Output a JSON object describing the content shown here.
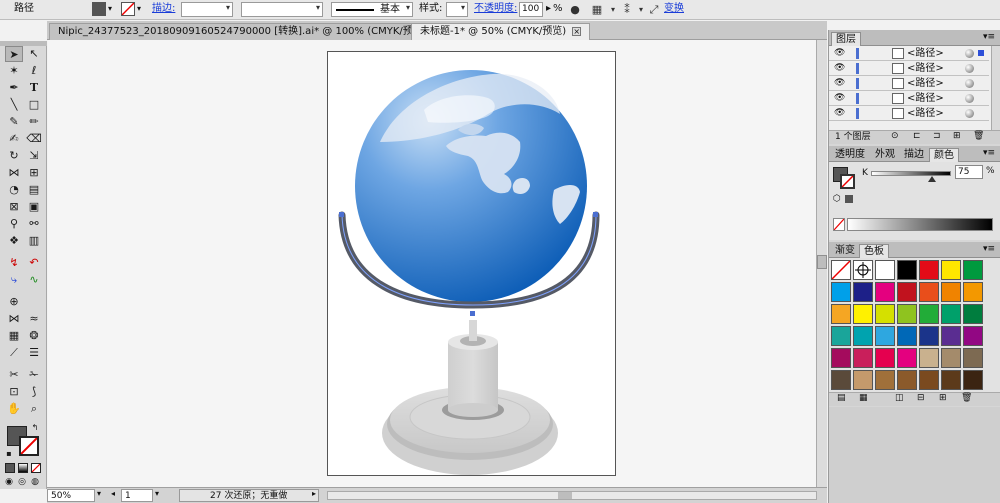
{
  "control_bar": {
    "object_type": "路径",
    "stroke_label": "描边:",
    "stroke_profile": "基本",
    "style_label": "样式:",
    "opacity_label": "不透明度:",
    "opacity_value": "100",
    "opacity_unit": "%",
    "transform_label": "变换"
  },
  "tabs": [
    {
      "title": "Nipic_24377523_20180909160524790000   [转换].ai* @ 100% (CMYK/预览)"
    },
    {
      "title": "未标题-1* @ 50% (CMYK/预览)"
    }
  ],
  "status_bar": {
    "zoom": "50%",
    "artboard_index": "1",
    "message": "27 次还原；无重做"
  },
  "layers_panel": {
    "title": "图层",
    "rows": [
      {
        "name": "<路径>"
      },
      {
        "name": "<路径>"
      },
      {
        "name": "<路径>"
      },
      {
        "name": "<路径>"
      },
      {
        "name": "<路径>"
      }
    ],
    "layer_count": "1 个图层"
  },
  "color_panel": {
    "tabs": [
      "透明度",
      "外观",
      "描边",
      "颜色"
    ],
    "channel_label": "K",
    "channel_value": "75",
    "channel_unit": "%",
    "channel_fraction": 0.75
  },
  "swatches_panel": {
    "tabs": [
      "渐变",
      "色板"
    ],
    "colors": [
      "none",
      "registration",
      "#ffffff",
      "#000000",
      "#e30b17",
      "#ffe600",
      "#009a3e",
      "#00a0e9",
      "#1d2088",
      "#e4007f",
      "#c1121e",
      "#e94e1b",
      "#f08300",
      "#f39800",
      "#f5a623",
      "#fff100",
      "#d5e000",
      "#8fc31f",
      "#22ac38",
      "#00a06a",
      "#007d3e",
      "#1aa59a",
      "#00a3af",
      "#2ea7e0",
      "#0068b7",
      "#1b348a",
      "#5a2d91",
      "#920783",
      "#a40b5d",
      "#c91f5b",
      "#e5004f",
      "#e4007f",
      "#c9b18e",
      "#a48b6b",
      "#7d6a52",
      "#5a4a3a",
      "#c49a6c",
      "#a0703a",
      "#8b5a2b",
      "#7a4a1f",
      "#5c3a1a",
      "#3b2412"
    ]
  },
  "colors": {
    "globe_light": "#b8d4f0",
    "globe_dark": "#0a5bb5",
    "stand_gray": "#d4d4d4",
    "meridian": "#555a66",
    "fill_swatch": "#555555"
  }
}
